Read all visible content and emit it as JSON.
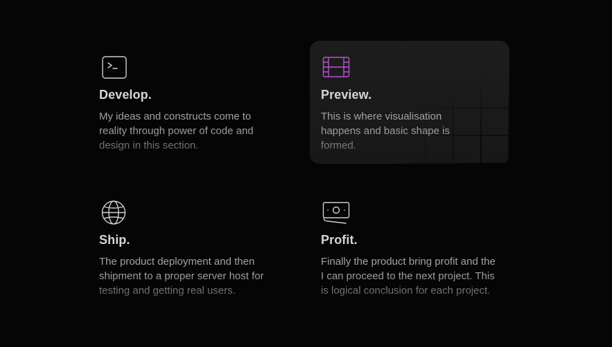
{
  "colors": {
    "background": "#050505",
    "card_highlight": "#1b1b1b",
    "icon_default": "#cfcfcf",
    "icon_accent": "#c04fd6",
    "title": "#d6d6d6",
    "text": "#a3a3a3"
  },
  "features": [
    {
      "icon": "terminal-icon",
      "title": "Develop.",
      "description": "My ideas and constructs come to reality through power of code and design in this section."
    },
    {
      "icon": "film-icon",
      "title": "Preview.",
      "description": "This is where visualisation happens and basic shape is formed."
    },
    {
      "icon": "globe-icon",
      "title": "Ship.",
      "description": "The product deployment and then shipment to a proper server host for testing and getting real users."
    },
    {
      "icon": "money-icon",
      "title": "Profit.",
      "description": "Finally the product bring profit and the I can proceed to the next project. This is logical conclusion for each project."
    }
  ]
}
